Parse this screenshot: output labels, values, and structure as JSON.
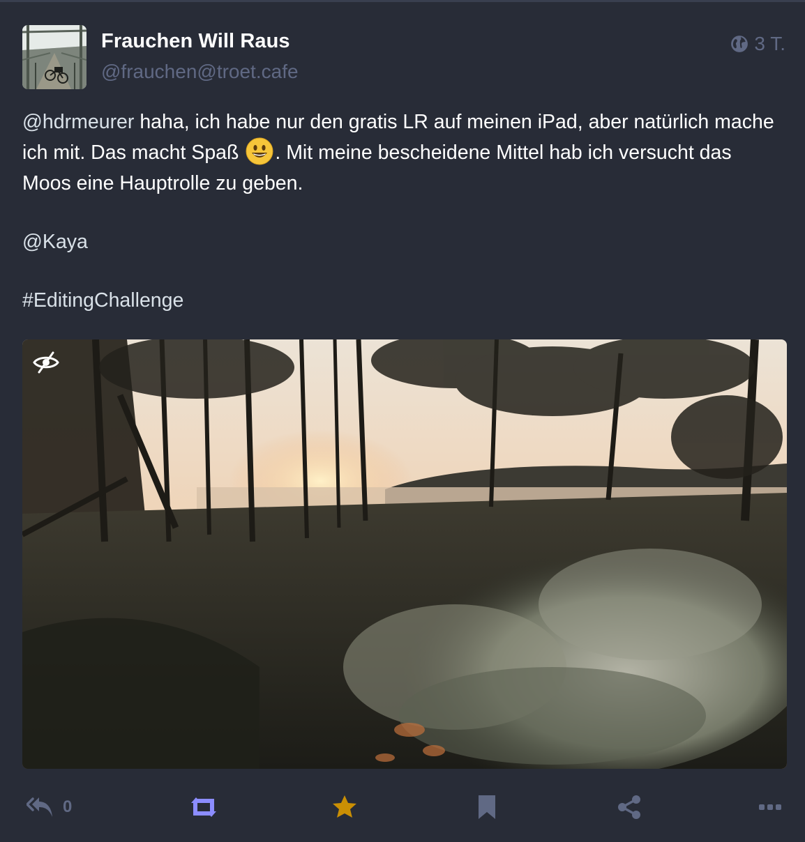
{
  "status": {
    "display_name": "Frauchen Will Raus",
    "account": "@frauchen@troet.cafe",
    "visibility_icon": "globe-icon",
    "relative_time": "3 T.",
    "content": {
      "mention_hdrmeurer": "@hdrmeurer",
      "text_part1": "  haha, ich habe nur den gratis LR auf meinen iPad, aber natürlich mache ich mit. Das macht Spaß",
      "emoji": "😃",
      "text_part2": ". Mit meine bescheidene Mittel hab ich versucht das Moos eine Hauptrolle zu geben.",
      "mention_kaya": "@Kaya",
      "hashtag": "#EditingChallenge"
    },
    "media": {
      "hide_icon": "eye-slash-icon"
    },
    "actions": {
      "reply_icon": "reply-all-icon",
      "reply_count": "0",
      "boost_icon": "retweet-icon",
      "favourite_icon": "star-icon",
      "bookmark_icon": "bookmark-icon",
      "share_icon": "share-icon",
      "more_icon": "ellipsis-icon"
    }
  },
  "colors": {
    "background": "#282c37",
    "secondary_text": "#606984",
    "boost_active": "#8c8dff",
    "favourite_active": "#ca8f04",
    "text": "#ffffff"
  }
}
